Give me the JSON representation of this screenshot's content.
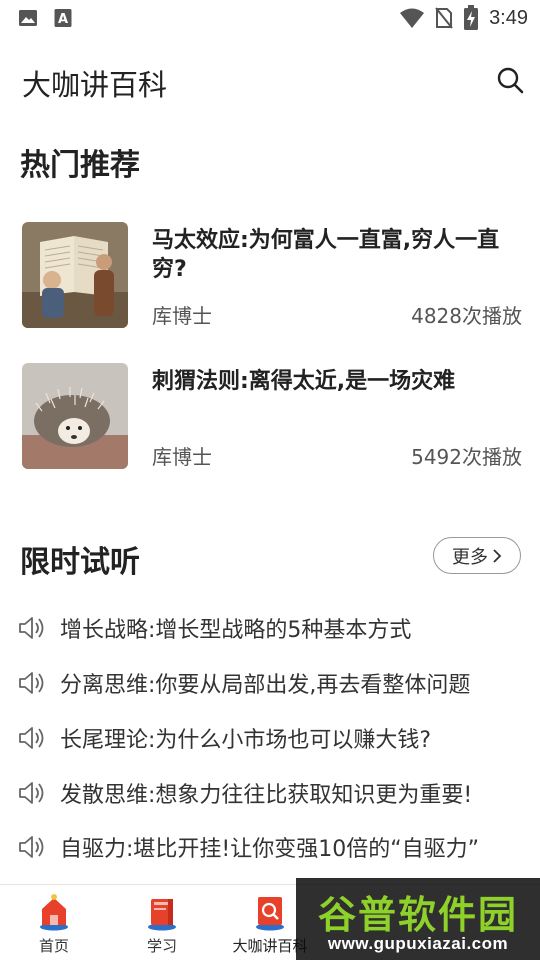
{
  "status_bar": {
    "time": "3:49",
    "left_icons": [
      "image-icon",
      "keyboard-a-icon"
    ],
    "right_icons": [
      "wifi-icon",
      "no-sim-icon",
      "battery-charging-icon"
    ]
  },
  "app_bar": {
    "title": "大咖讲百科",
    "search_icon": "search-icon"
  },
  "hot": {
    "title": "热门推荐",
    "items": [
      {
        "name": "马太效应:为何富人一直富,穷人一直穷?",
        "author": "库博士",
        "plays": "4828次播放",
        "thumb": "book-figures-image"
      },
      {
        "name": "刺猬法则:离得太近,是一场灾难",
        "author": "库博士",
        "plays": "5492次播放",
        "thumb": "hedgehog-image"
      }
    ]
  },
  "trial": {
    "title": "限时试听",
    "more_label": "更多",
    "items": [
      {
        "text": "增长战略:增长型战略的5种基本方式"
      },
      {
        "text": "分离思维:你要从局部出发,再去看整体问题"
      },
      {
        "text": "长尾理论:为什么小市场也可以赚大钱?"
      },
      {
        "text": "发散思维:想象力往往比获取知识更为重要!"
      },
      {
        "text": "自驱力:堪比开挂!让你变强10倍的“自驱力”"
      }
    ]
  },
  "tabs": [
    {
      "label": "首页",
      "icon": "home-icon"
    },
    {
      "label": "学习",
      "icon": "book-icon"
    },
    {
      "label": "大咖讲百科",
      "icon": "encyclopedia-search-icon",
      "active": true
    }
  ],
  "watermark": {
    "title": "谷普软件园",
    "url": "www.gupuxiazai.com"
  },
  "colors": {
    "accent": "#e8412b",
    "watermark_green": "#8ed12a"
  }
}
